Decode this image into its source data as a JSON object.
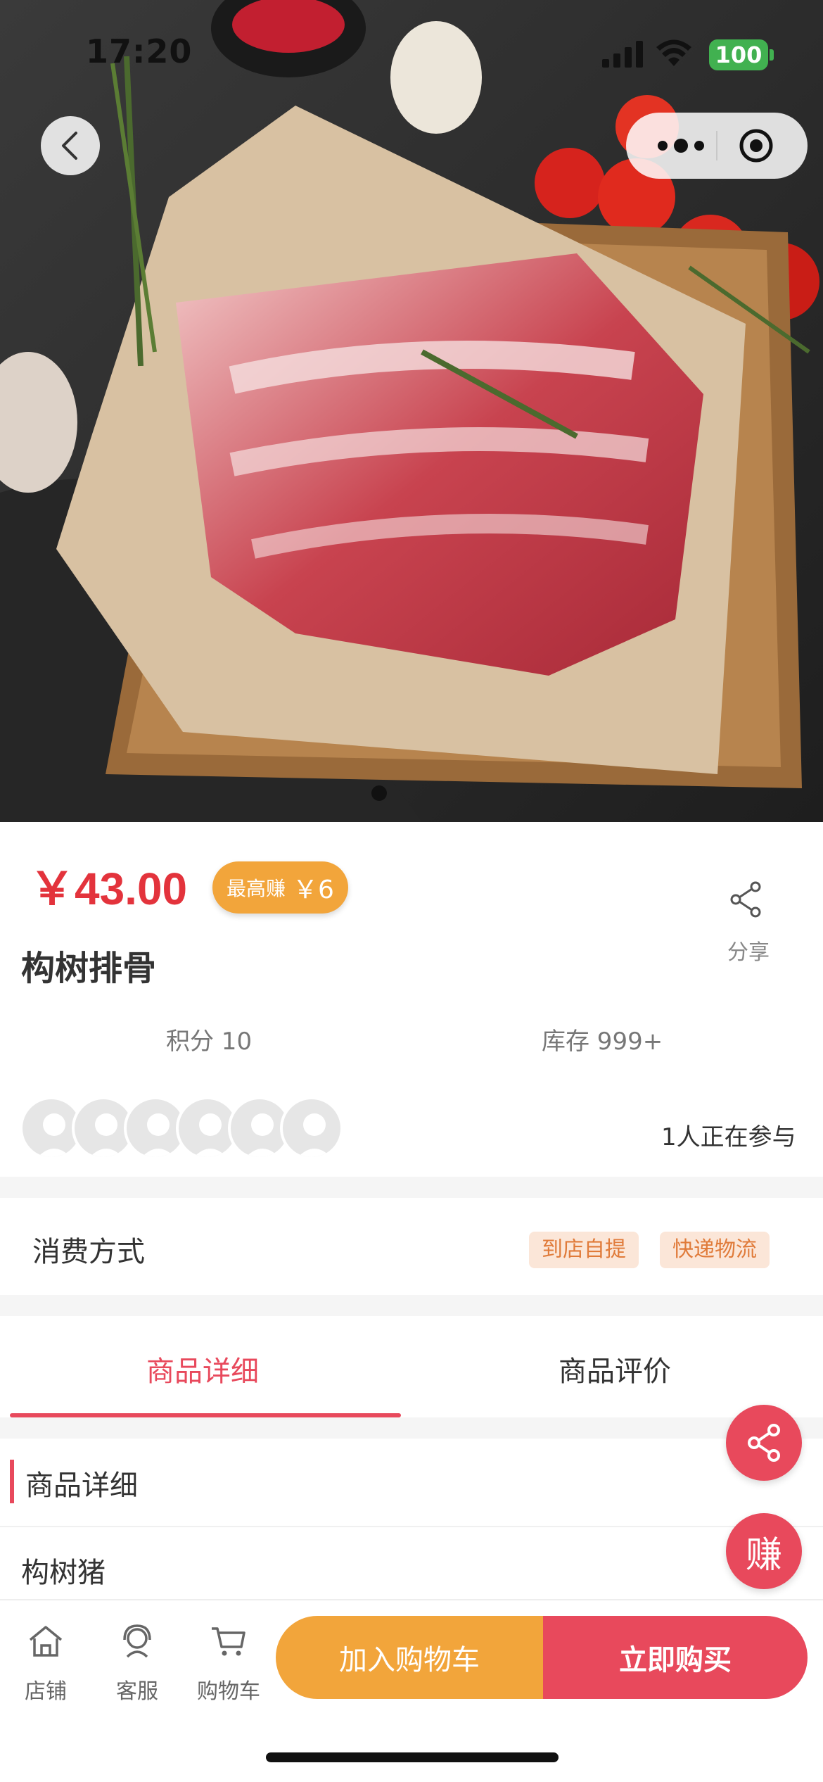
{
  "status_bar": {
    "time": "17:20",
    "battery": "100"
  },
  "product": {
    "price": "￥43.00",
    "earn_label": "最高赚",
    "earn_value": "￥6",
    "share_label": "分享",
    "title": "构树排骨",
    "points": "积分 10",
    "stock": "库存 999+",
    "participants": "1人正在参与"
  },
  "consume": {
    "label": "消费方式",
    "tags": [
      "到店自提",
      "快递物流"
    ]
  },
  "tabs": [
    "商品详细",
    "商品评价"
  ],
  "detail": {
    "section_title": "商品详细",
    "body": "构树猪"
  },
  "fab": {
    "earn_label": "赚"
  },
  "bottom_nav": {
    "items": [
      "店铺",
      "客服",
      "购物车"
    ],
    "add_to_cart": "加入购物车",
    "buy_now": "立即购买"
  },
  "colors": {
    "accent": "#e8495c",
    "orange": "#f2a53b",
    "price": "#e3333c"
  },
  "icons": [
    "back-icon",
    "more-dots-icon",
    "target-icon",
    "share-icon",
    "store-icon",
    "service-icon",
    "cart-icon"
  ]
}
